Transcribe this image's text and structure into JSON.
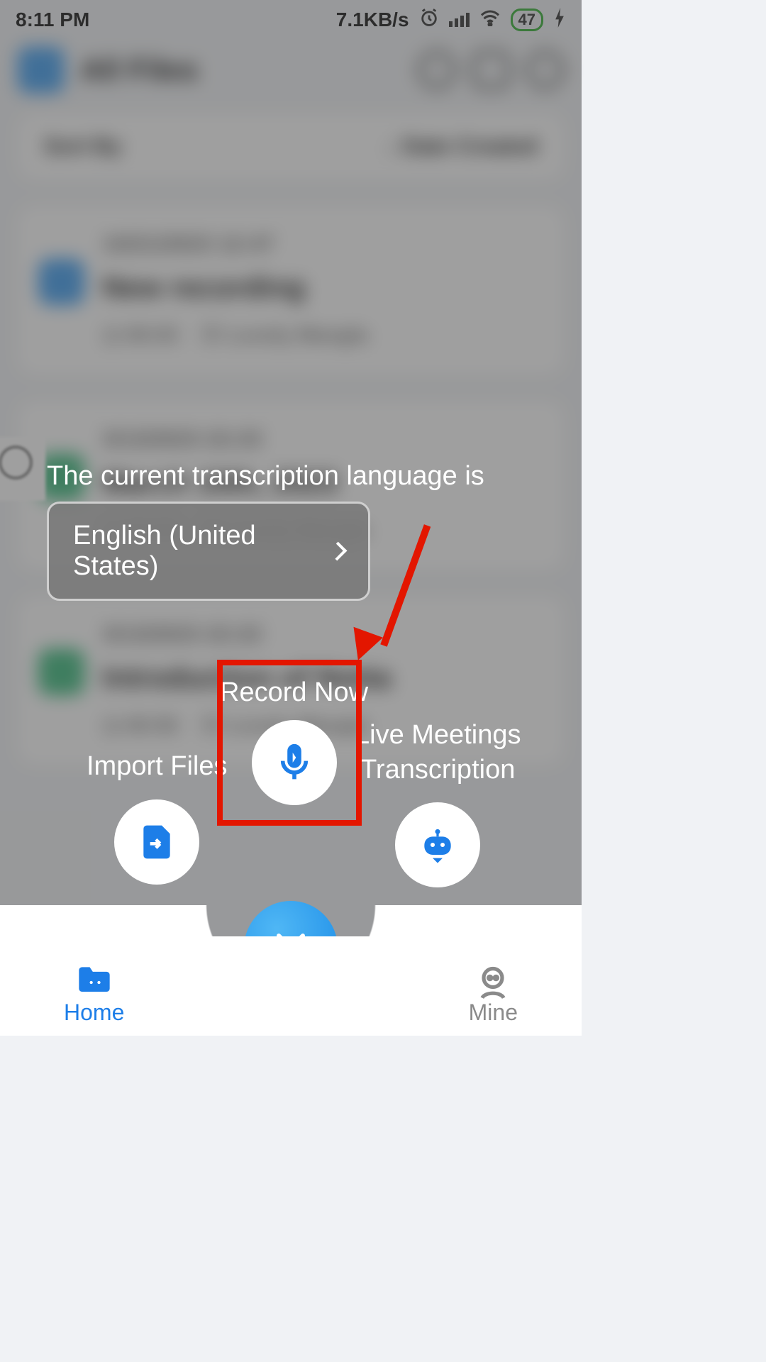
{
  "statusbar": {
    "time": "8:11 PM",
    "net_rate": "7.1KB/s",
    "battery": "47"
  },
  "header": {
    "title": "All Files"
  },
  "sort": {
    "label": "Sort By",
    "value": "Date Created"
  },
  "files": [
    {
      "date": "10/21/2023  12:47",
      "name": "New recording",
      "duration": "00:03",
      "owner": "Lovely Mangla",
      "color": "blue"
    },
    {
      "date": "3/13/2023  22:23",
      "name": "March 10th, 2023",
      "duration": "00:00",
      "owner": "Lovely Mangla",
      "color": "green"
    },
    {
      "date": "3/13/2023  22:22",
      "name": "Introduction of Notta",
      "duration": "00:55",
      "owner": "Lovely Mangla",
      "color": "green"
    }
  ],
  "popover": {
    "label": "The current transcription language is",
    "language": "English (United States)"
  },
  "actions": {
    "record": "Record Now",
    "import": "Import Files",
    "live": "Live Meetings\nTranscription"
  },
  "tabs": {
    "home": "Home",
    "mine": "Mine"
  },
  "colors": {
    "accent": "#1d7ee8",
    "annotation": "#e31600"
  }
}
